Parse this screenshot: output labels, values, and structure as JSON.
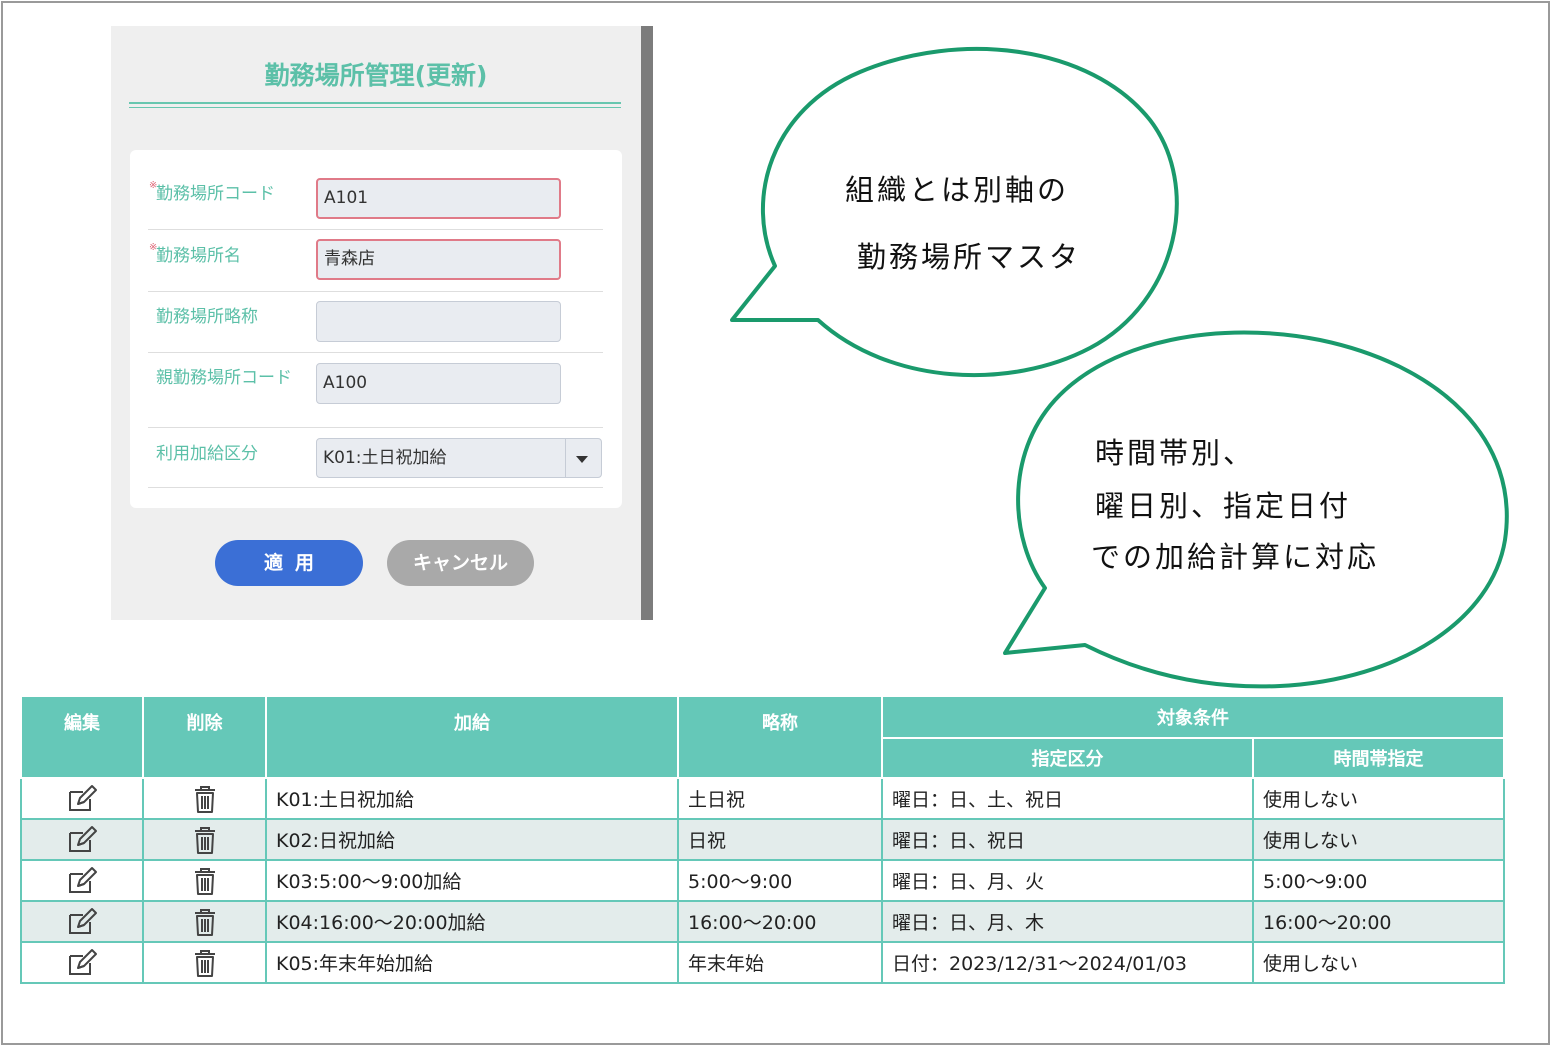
{
  "panel": {
    "title": "勤務場所管理(更新)",
    "required_mark": "※",
    "fields": [
      {
        "label": "勤務場所コード",
        "value": "A101",
        "required": true
      },
      {
        "label": "勤務場所名",
        "value": "青森店",
        "required": true
      },
      {
        "label": "勤務場所略称",
        "value": "",
        "required": false
      },
      {
        "label": "親勤務場所コード",
        "value": "A100",
        "required": false
      },
      {
        "label": "利用加給区分",
        "value": "K01:土日祝加給",
        "required": false
      }
    ],
    "apply_label": "適用",
    "cancel_label": "キャンセル"
  },
  "callouts": [
    {
      "lines": [
        "組織とは別軸の",
        "勤務場所マスタ"
      ]
    },
    {
      "lines": [
        "時間帯別、",
        "曜日別、指定日付",
        "での加給計算に対応"
      ]
    }
  ],
  "table": {
    "headers": {
      "edit": "編集",
      "delete": "削除",
      "allowance": "加給",
      "abbrev": "略称",
      "conditions": "対象条件",
      "designation": "指定区分",
      "time_slot": "時間帯指定"
    },
    "rows": [
      {
        "allowance": "K01:土日祝加給",
        "abbrev": "土日祝",
        "designation": "曜日：日、土、祝日",
        "time_slot": "使用しない"
      },
      {
        "allowance": "K02:日祝加給",
        "abbrev": "日祝",
        "designation": "曜日：日、祝日",
        "time_slot": "使用しない"
      },
      {
        "allowance": "K03:5:00～9:00加給",
        "abbrev": "5:00～9:00",
        "designation": "曜日：日、月、火",
        "time_slot": "5:00～9:00"
      },
      {
        "allowance": "K04:16:00～20:00加給",
        "abbrev": "16:00～20:00",
        "designation": "曜日：日、月、木",
        "time_slot": "16:00～20:00"
      },
      {
        "allowance": "K05:年末年始加給",
        "abbrev": "年末年始",
        "designation": "日付：2023/12/31～2024/01/03",
        "time_slot": "使用しない"
      }
    ]
  },
  "icons": {
    "edit": "edit-icon",
    "delete": "trash-icon",
    "dropdown": "chevron-down-icon"
  },
  "colors": {
    "accent": "#65c8b8",
    "apply": "#3b6fd6",
    "cancel": "#a9a9a9",
    "bubble_border": "#1a9a6c",
    "required": "#e07a88"
  }
}
